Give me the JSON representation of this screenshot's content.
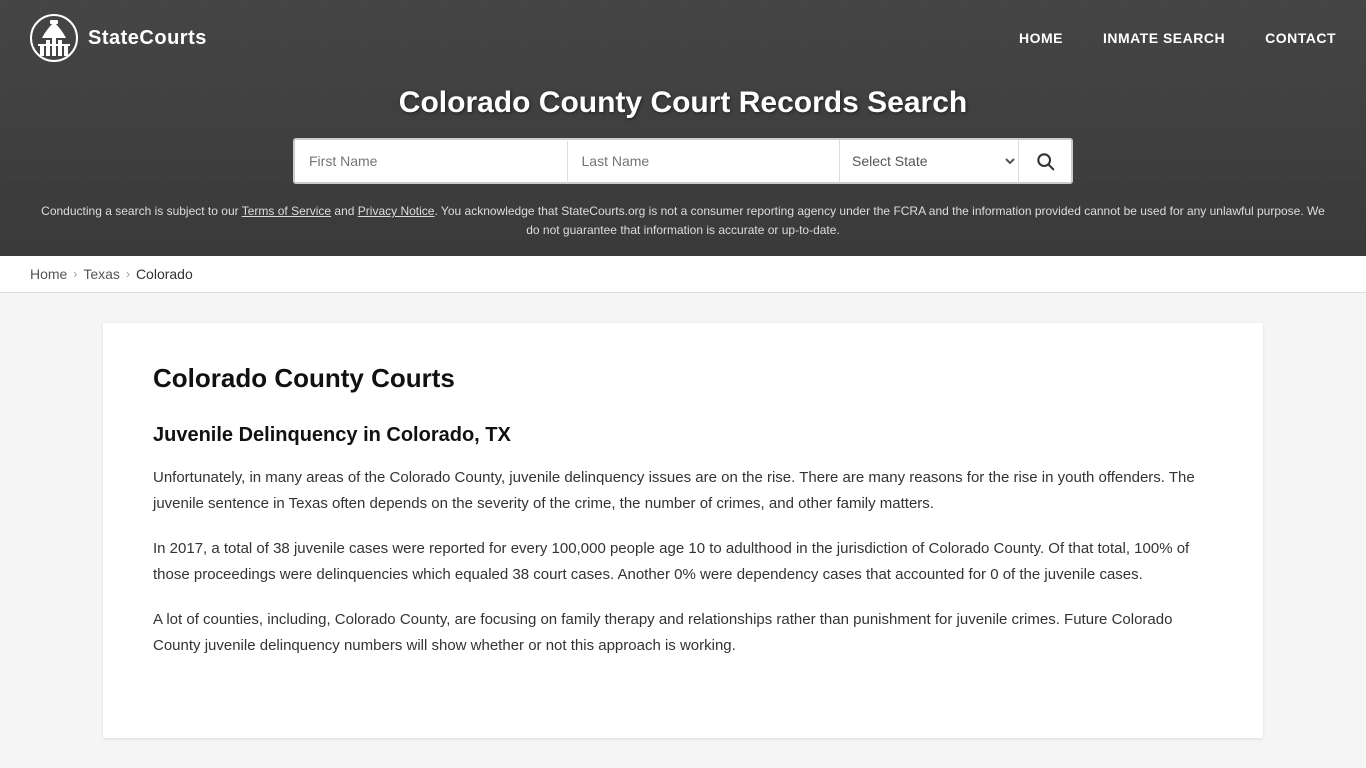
{
  "site": {
    "logo_text": "StateCourts",
    "nav": {
      "home": "HOME",
      "inmate_search": "INMATE SEARCH",
      "contact": "CONTACT"
    }
  },
  "header": {
    "page_title": "Colorado County Court Records Search",
    "search": {
      "first_name_placeholder": "First Name",
      "last_name_placeholder": "Last Name",
      "state_select_label": "Select State",
      "button_label": "🔍"
    },
    "disclaimer": "Conducting a search is subject to our Terms of Service and Privacy Notice. You acknowledge that StateCourts.org is not a consumer reporting agency under the FCRA and the information provided cannot be used for any unlawful purpose. We do not guarantee that information is accurate or up-to-date."
  },
  "breadcrumb": {
    "home": "Home",
    "state": "Texas",
    "county": "Colorado"
  },
  "main": {
    "section_title": "Colorado County Courts",
    "subsection_title": "Juvenile Delinquency in Colorado, TX",
    "paragraphs": [
      "Unfortunately, in many areas of the Colorado County, juvenile delinquency issues are on the rise. There are many reasons for the rise in youth offenders. The juvenile sentence in Texas often depends on the severity of the crime, the number of crimes, and other family matters.",
      "In 2017, a total of 38 juvenile cases were reported for every 100,000 people age 10 to adulthood in the jurisdiction of Colorado County. Of that total, 100% of those proceedings were delinquencies which equaled 38 court cases. Another 0% were dependency cases that accounted for 0 of the juvenile cases.",
      "A lot of counties, including, Colorado County, are focusing on family therapy and relationships rather than punishment for juvenile crimes. Future Colorado County juvenile delinquency numbers will show whether or not this approach is working."
    ]
  }
}
